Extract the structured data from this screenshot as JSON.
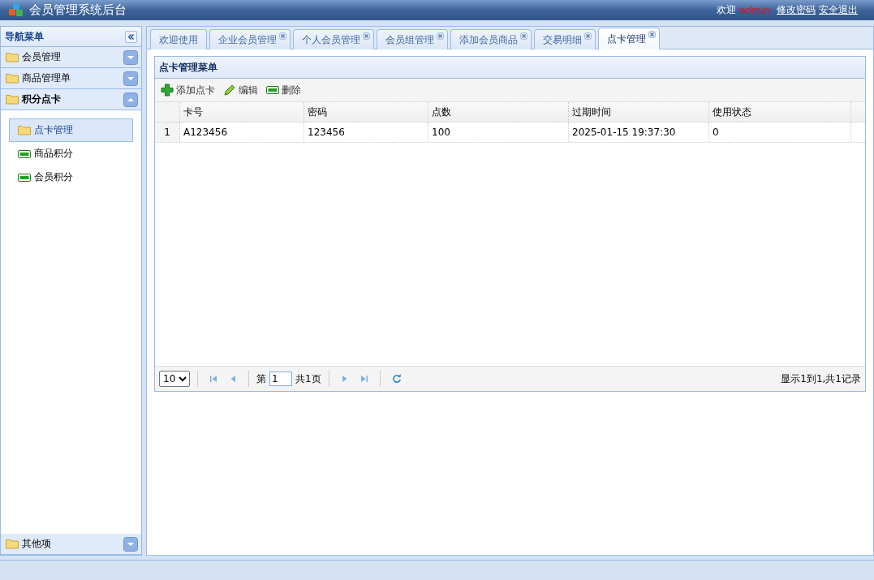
{
  "header": {
    "title": "会员管理系统后台",
    "welcome": "欢迎",
    "user": "admin",
    "links": [
      "修改密码",
      "安全退出"
    ]
  },
  "sidebar": {
    "title": "导航菜单",
    "sections": [
      {
        "label": "会员管理",
        "expanded": false
      },
      {
        "label": "商品管理单",
        "expanded": false
      },
      {
        "label": "积分点卡",
        "expanded": true,
        "items": [
          {
            "label": "点卡管理",
            "kind": "folder",
            "selected": true
          },
          {
            "label": "商品积分",
            "kind": "card",
            "selected": false
          },
          {
            "label": "会员积分",
            "kind": "card",
            "selected": false
          }
        ]
      },
      {
        "label": "其他项",
        "expanded": false
      }
    ]
  },
  "tabs": [
    {
      "label": "欢迎使用",
      "closable": false,
      "selected": false
    },
    {
      "label": "企业会员管理",
      "closable": true,
      "selected": false
    },
    {
      "label": "个人会员管理",
      "closable": true,
      "selected": false
    },
    {
      "label": "会员组管理",
      "closable": true,
      "selected": false
    },
    {
      "label": "添加会员商品",
      "closable": true,
      "selected": false
    },
    {
      "label": "交易明细",
      "closable": true,
      "selected": false
    },
    {
      "label": "点卡管理",
      "closable": true,
      "selected": true
    }
  ],
  "panel": {
    "title": "点卡管理菜单",
    "toolbar": [
      {
        "label": "添加点卡",
        "kind": "add"
      },
      {
        "label": "编辑",
        "kind": "edit"
      },
      {
        "label": "删除",
        "kind": "delete"
      }
    ],
    "table": {
      "columns": [
        "卡号",
        "密码",
        "点数",
        "过期时间",
        "使用状态"
      ],
      "rows": [
        {
          "number": "1",
          "cells": [
            "A123456",
            "123456",
            "100",
            "2025-01-15 19:37:30",
            "0"
          ]
        }
      ]
    },
    "pager": {
      "page_size": "10",
      "page_prefix": "第",
      "page": "1",
      "page_total": "共1页",
      "summary": "显示1到1,共1记录"
    }
  }
}
